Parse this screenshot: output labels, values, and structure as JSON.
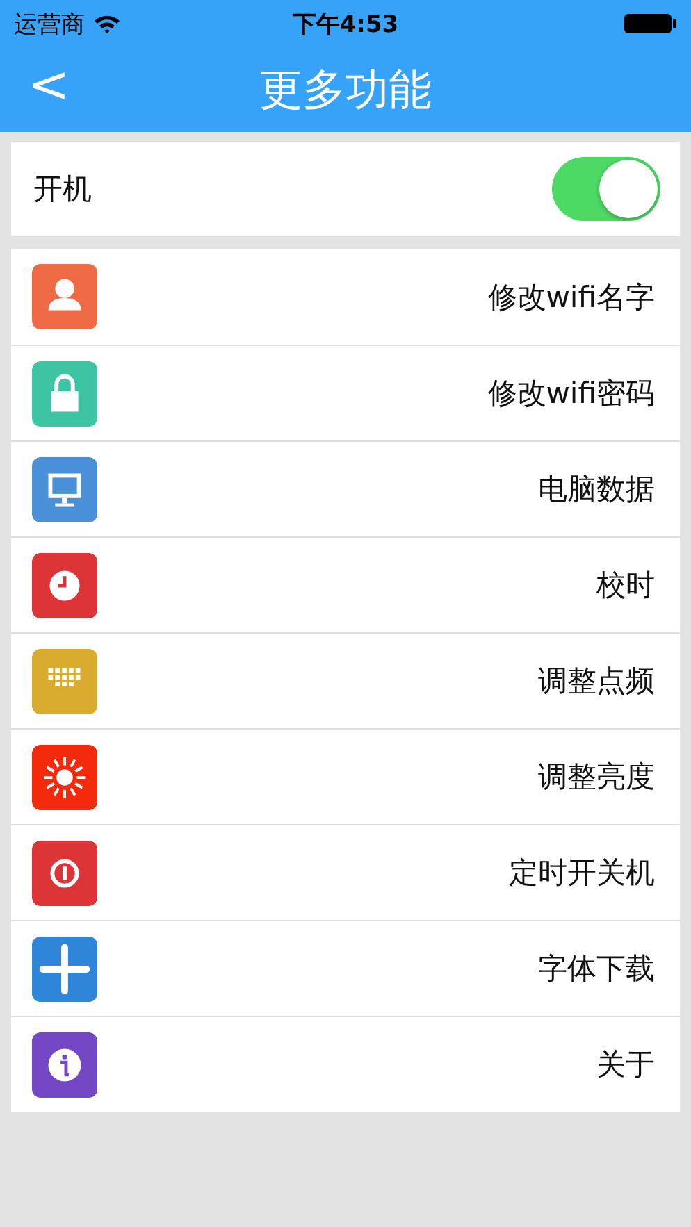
{
  "status_bar": {
    "carrier": "运营商",
    "time": "下午4:53"
  },
  "nav": {
    "back": "<",
    "title": "更多功能"
  },
  "power": {
    "label": "开机",
    "on": true
  },
  "items": [
    {
      "label": "修改wifi名字",
      "color": "#ee6a45"
    },
    {
      "label": "修改wifi密码",
      "color": "#3ec4a3"
    },
    {
      "label": "电脑数据",
      "color": "#4a90d9"
    },
    {
      "label": "校时",
      "color": "#dd3438"
    },
    {
      "label": "调整点频",
      "color": "#d9ac2f"
    },
    {
      "label": "调整亮度",
      "color": "#f42a0c"
    },
    {
      "label": "定时开关机",
      "color": "#dd3438"
    },
    {
      "label": "字体下载",
      "color": "#2f86d8"
    },
    {
      "label": "关于",
      "color": "#7448c4"
    }
  ]
}
